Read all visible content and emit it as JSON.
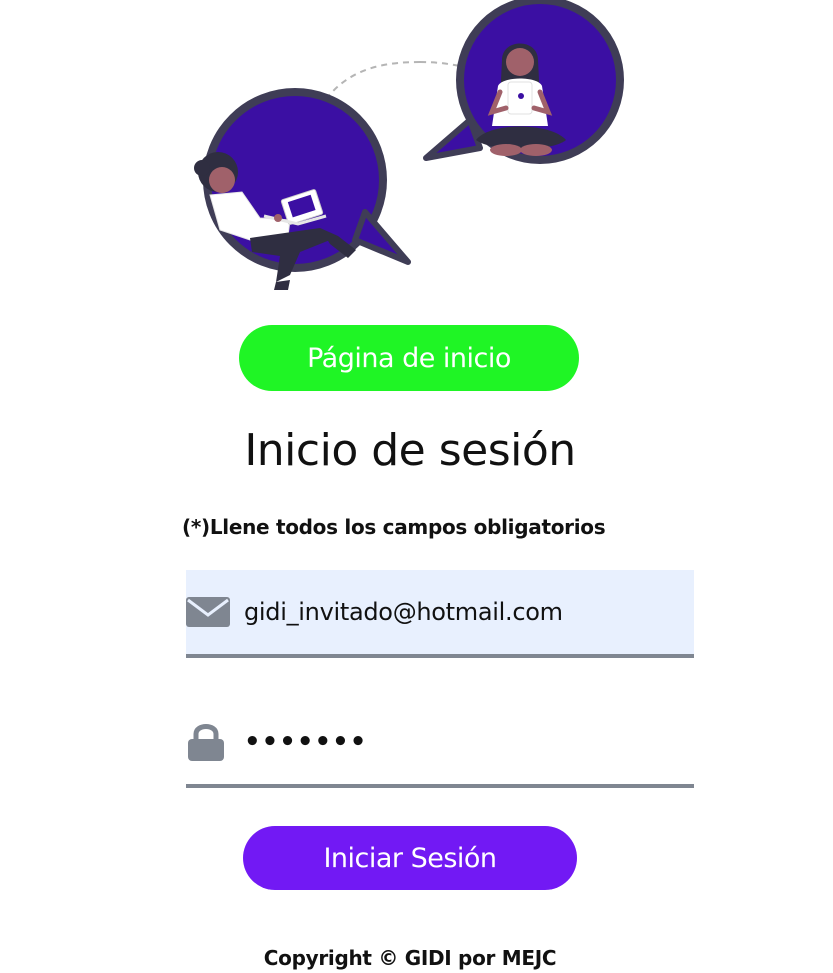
{
  "illustration": {
    "name": "two people chatting in speech bubbles",
    "colors": {
      "bubble": "#3b0fa3",
      "bubble_outline": "#3f3d56",
      "skin": "#a0616a",
      "hair": "#2f2e41",
      "shirt": "#ffffff",
      "pants": "#2f2e41"
    }
  },
  "home_button": {
    "label": "Página de inicio",
    "color": "#1ff525"
  },
  "title": "Inicio de sesión",
  "required_note": "(*)Llene todos los campos obligatorios",
  "email_field": {
    "value": "gidi_invitado@hotmail.com",
    "icon": "envelope-icon",
    "background": "#e8f0fe"
  },
  "password_field": {
    "value": "•••••••",
    "icon": "lock-icon"
  },
  "login_button": {
    "label": "Iniciar Sesión",
    "color": "#7219f4"
  },
  "footer": {
    "copyright": "Copyright © GIDI por MEJC"
  }
}
